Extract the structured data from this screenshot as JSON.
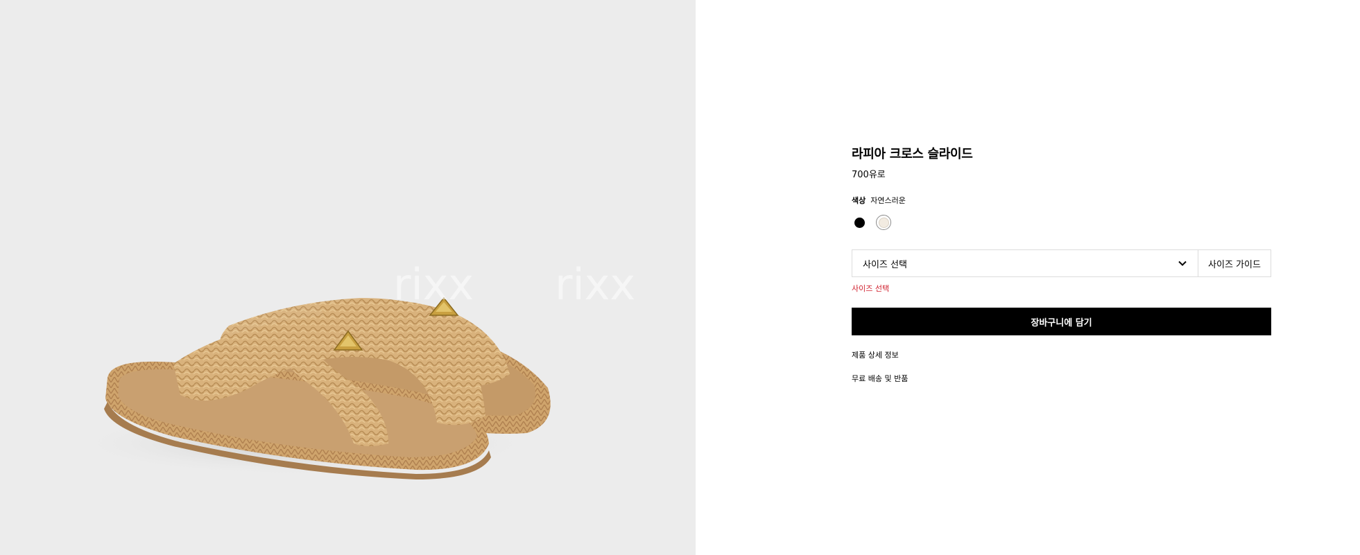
{
  "product": {
    "title": "라피아 크로스 슬라이드",
    "price": "700유로"
  },
  "color": {
    "label": "색상",
    "selected_name": "자연스러운",
    "swatches": [
      {
        "name": "black",
        "color": "#000000"
      },
      {
        "name": "natural",
        "color": "#f2ebe1",
        "selected": true
      }
    ]
  },
  "size": {
    "select_label": "사이즈 선택",
    "guide_label": "사이즈 가이드",
    "error_message": "사이즈 선택"
  },
  "actions": {
    "add_to_cart": "장바구니에 담기"
  },
  "links": {
    "product_details": "제품 상세 정보",
    "shipping_returns": "무료 배송 및 반품"
  },
  "image": {
    "watermark": "rixx"
  },
  "colors": {
    "image_background": "#ececec",
    "error_red": "#d0202e",
    "button_black": "#000000"
  }
}
